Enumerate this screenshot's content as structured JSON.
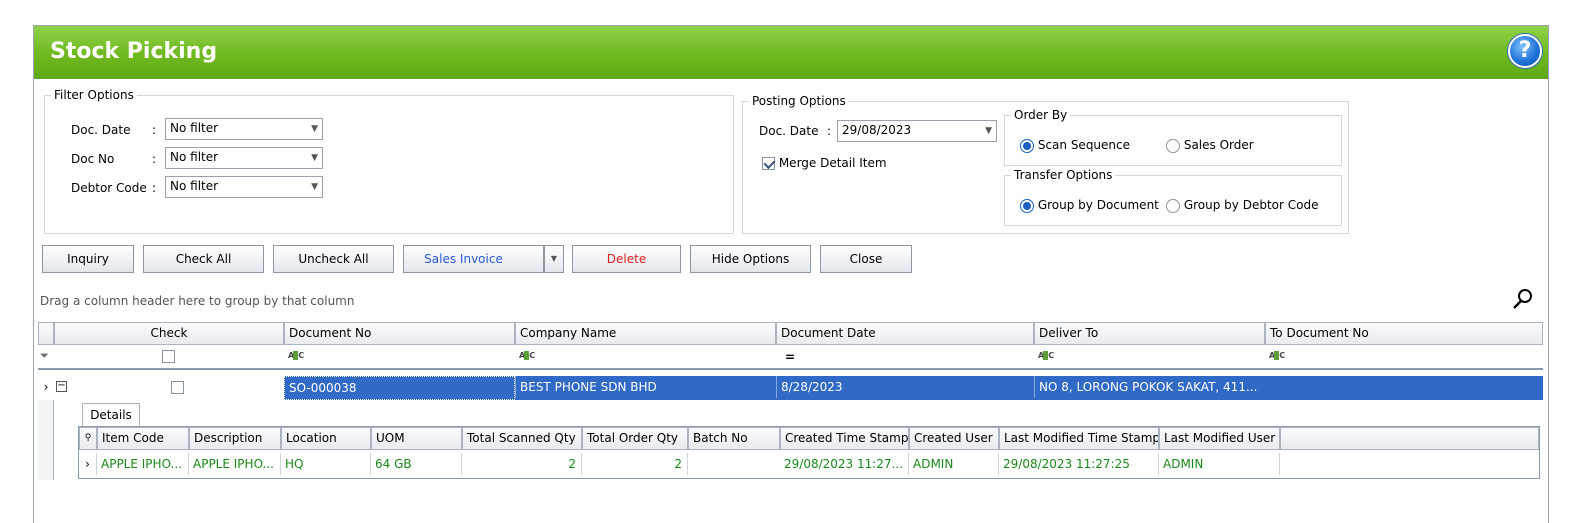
{
  "window": {
    "title": "Stock Picking",
    "help_label": "?"
  },
  "filter": {
    "legend": "Filter Options",
    "fields": [
      {
        "label": "Doc. Date",
        "sep": ":",
        "value": "No filter"
      },
      {
        "label": "Doc No",
        "sep": ":",
        "value": "No filter"
      },
      {
        "label": "Debtor Code",
        "sep": ":",
        "value": "No filter"
      }
    ]
  },
  "posting": {
    "legend": "Posting Options",
    "doc_date_label": "Doc. Date",
    "doc_date_sep": ":",
    "doc_date_value": "29/08/2023",
    "merge_label": "Merge Detail Item",
    "merge_checked": true,
    "order_by": {
      "legend": "Order By",
      "options": [
        "Scan Sequence",
        "Sales Order"
      ],
      "selected": "Scan Sequence"
    },
    "transfer": {
      "legend": "Transfer Options",
      "options": [
        "Group by Document",
        "Group by Debtor Code"
      ],
      "selected": "Group by Document"
    }
  },
  "toolbar": {
    "inquiry": "Inquiry",
    "check_all": "Check All",
    "uncheck_all": "Uncheck All",
    "sales_invoice": "Sales Invoice",
    "delete": "Delete",
    "hide_options": "Hide Options",
    "close": "Close"
  },
  "grid": {
    "group_hint": "Drag a column header here to group by that column",
    "columns": [
      "Check",
      "Document No",
      "Company Name",
      "Document Date",
      "Deliver To",
      "To Document No"
    ],
    "filter_date_symbol": "=",
    "row": {
      "document_no": "SO-000038",
      "company_name": "BEST PHONE SDN BHD",
      "document_date": "8/28/2023",
      "deliver_to": "NO 8, LORONG POKOK SAKAT, 411...",
      "to_document_no": ""
    },
    "detail_tab": "Details",
    "detail_columns": [
      "Item Code",
      "Description",
      "Location",
      "UOM",
      "Total Scanned Qty",
      "Total Order Qty",
      "Batch No",
      "Created Time Stamp",
      "Created User",
      "Last Modified Time Stamp",
      "Last Modified User"
    ],
    "detail_row": {
      "item_code": "APPLE IPHO...",
      "description": "APPLE IPHO...",
      "location": "HQ",
      "uom": "64 GB",
      "total_scanned_qty": "2",
      "total_order_qty": "2",
      "batch_no": "",
      "created_time_stamp": "29/08/2023 11:27...",
      "created_user": "ADMIN",
      "last_modified_time_stamp": "29/08/2023 11:27:25",
      "last_modified_user": "ADMIN"
    }
  },
  "colors": {
    "title_bar": "#6fb81f",
    "selection": "#3169c6",
    "detail_text": "#1a8a1a",
    "delete_text": "#e02020",
    "sales_invoice_text": "#2a5bd7"
  }
}
